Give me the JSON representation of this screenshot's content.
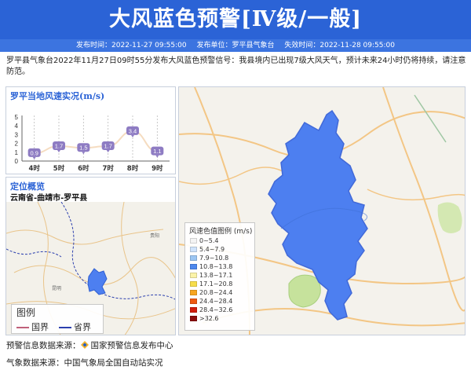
{
  "header": {
    "title": "大风蓝色预警[Ⅳ级/一般]",
    "publish_time": "发布时间：2022-11-27 09:55:00",
    "publisher": "发布单位：罗平县气象台",
    "expire_time": "失效时间：2022-11-28 09:55:00"
  },
  "description": "罗平县气象台2022年11月27日09时55分发布大风蓝色预警信号：我县境内已出现7级大风天气，预计未来24小时仍将持续，请注意防范。",
  "wind_panel": {
    "title": "罗平当地风速实况(m/s)"
  },
  "chart_data": {
    "type": "line",
    "title": "罗平当地风速实况(m/s)",
    "categories": [
      "4时",
      "5时",
      "6时",
      "7时",
      "8时",
      "9时"
    ],
    "values": [
      0.9,
      1.7,
      1.5,
      1.7,
      3.4,
      1.1
    ],
    "ylim": [
      0,
      5
    ],
    "yticks": [
      0,
      1,
      2,
      3,
      4,
      5
    ],
    "grid": "vertical dashed",
    "line_color": "#f5dcc0",
    "label_color": "#8e7cc3"
  },
  "location_panel": {
    "title": "定位概览",
    "region": "云南省-曲靖市-罗平县",
    "map_labels": [
      "贵阳",
      "昆明"
    ],
    "legend": {
      "title": "图例",
      "items": [
        {
          "label": "国界",
          "color": "#c0607a"
        },
        {
          "label": "省界",
          "color": "#2b3fae"
        }
      ]
    }
  },
  "speed_legend": {
    "title": "风速色值图例 (m/s)",
    "items": [
      {
        "label": "0~5.4",
        "color": "#f4f4f4"
      },
      {
        "label": "5.4~7.9",
        "color": "#cfe3fb"
      },
      {
        "label": "7.9~10.8",
        "color": "#9cc6f3"
      },
      {
        "label": "10.8~13.8",
        "color": "#4d88ee"
      },
      {
        "label": "13.8~17.1",
        "color": "#fbf3a8"
      },
      {
        "label": "17.1~20.8",
        "color": "#f7dd4a"
      },
      {
        "label": "20.8~24.4",
        "color": "#f7a51f"
      },
      {
        "label": "24.4~28.4",
        "color": "#ef5a12"
      },
      {
        "label": "28.4~32.6",
        "color": "#d11d0c"
      },
      {
        "label": ">32.6",
        "color": "#8c0d0d"
      }
    ]
  },
  "big_map": {
    "region_color": "#4d7ff0",
    "border_color": "#4169d8"
  },
  "footer": {
    "warning_source": "预警信息数据来源：",
    "warning_source_name": "国家预警信息发布中心",
    "weather_source": "气象数据来源：中国气象局全国自动站实况"
  }
}
